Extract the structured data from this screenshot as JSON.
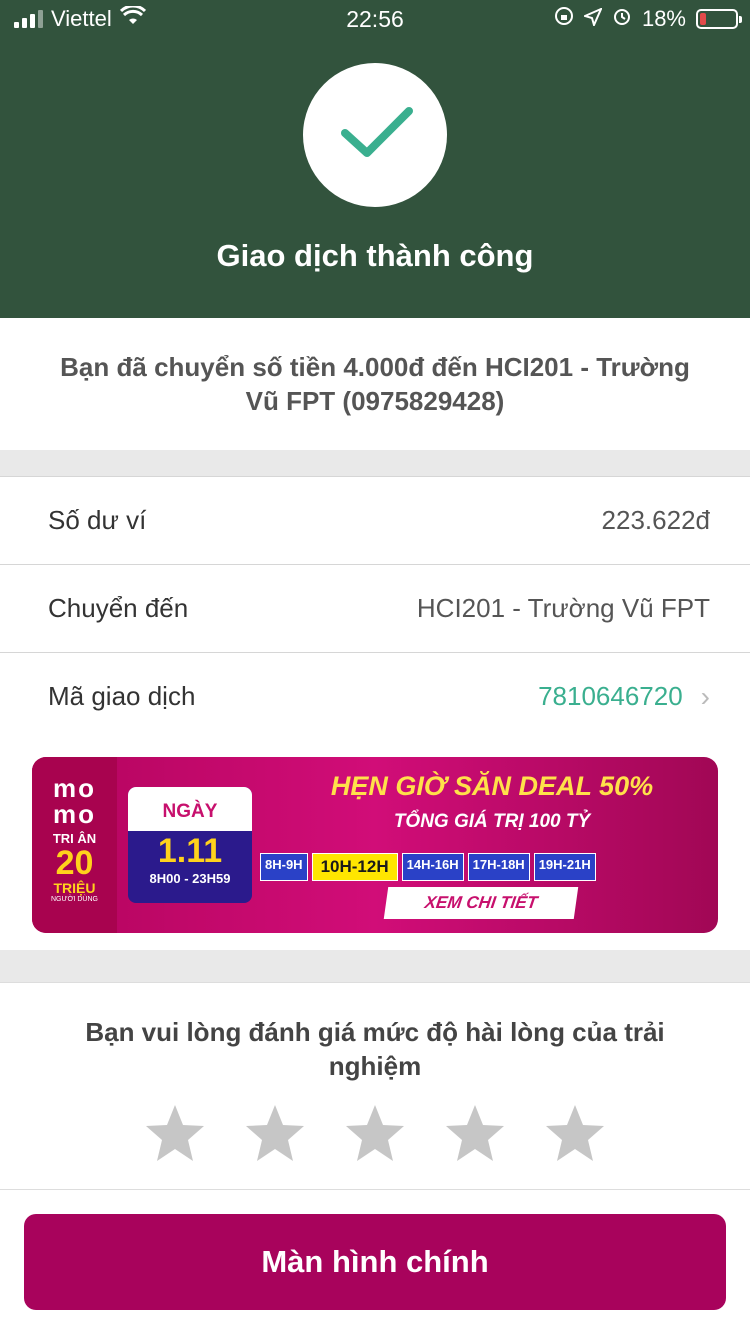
{
  "status_bar": {
    "carrier": "Viettel",
    "time": "22:56",
    "battery_pct": "18%"
  },
  "header": {
    "title": "Giao dịch thành công",
    "bg_color": "#32533d",
    "check_color": "#3aaf8f"
  },
  "message": {
    "text": "Bạn đã chuyển số tiền 4.000đ đến HCI201 - Trường Vũ FPT (0975829428)"
  },
  "details": [
    {
      "label": "Số dư ví",
      "value": "223.622đ"
    },
    {
      "label": "Chuyển đến",
      "value": "HCI201 - Trường Vũ FPT"
    },
    {
      "label": "Mã giao dịch",
      "value": "7810646720"
    }
  ],
  "banner": {
    "brand_top": "mo",
    "brand_bottom": "mo",
    "tri_an": "TRI ÂN",
    "twenty": "20",
    "trieu": "TRIỆU",
    "nguoi_dung": "NGƯỜI DÙNG",
    "cal_label": "NGÀY",
    "cal_date": "1.11",
    "cal_time": "8H00 - 23H59",
    "headline": "HẸN GIỜ SĂN DEAL 50%",
    "subline": "TỔNG GIÁ TRỊ 100 TỶ",
    "slots": [
      "8H-9H",
      "10H-12H",
      "14H-16H",
      "17H-18H",
      "19H-21H"
    ],
    "cta": "XEM CHI TIẾT"
  },
  "rating": {
    "prompt": "Bạn vui lòng đánh giá mức độ hài lòng của trải nghiệm",
    "stars_total": 5,
    "stars_selected": 0
  },
  "footer": {
    "button_label": "Màn hình chính",
    "button_color": "#a8035c"
  }
}
